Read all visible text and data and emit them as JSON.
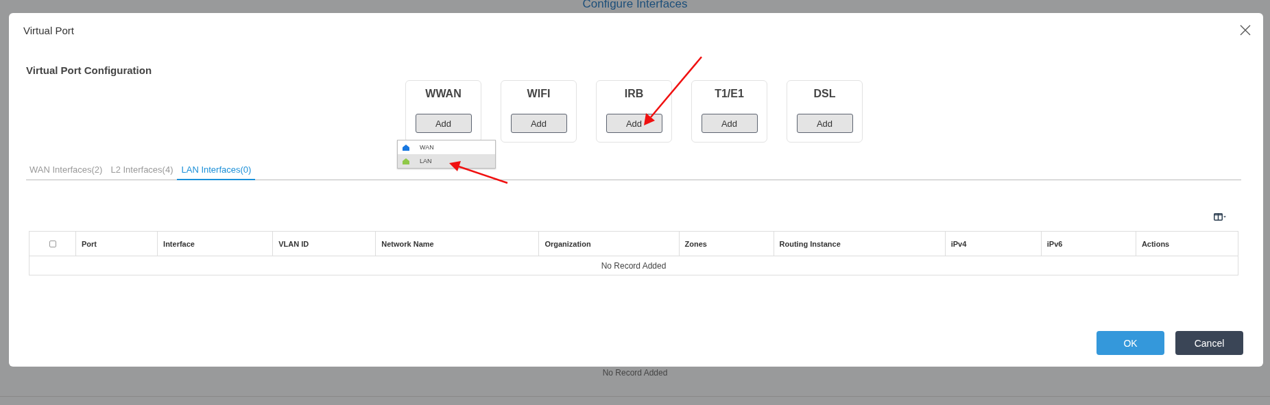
{
  "background": {
    "title": "Configure Interfaces",
    "empty_text": "No Record Added"
  },
  "dialog": {
    "title": "Virtual Port",
    "section_title": "Virtual Port Configuration",
    "port_types": [
      {
        "label": "WWAN",
        "button": "Add"
      },
      {
        "label": "WIFI",
        "button": "Add"
      },
      {
        "label": "IRB",
        "button": "Add"
      },
      {
        "label": "T1/E1",
        "button": "Add"
      },
      {
        "label": "DSL",
        "button": "Add"
      }
    ],
    "add_menu": [
      {
        "label": "WAN",
        "selected": false,
        "color": "#1877e0"
      },
      {
        "label": "LAN",
        "selected": true,
        "color": "#8fc848"
      }
    ],
    "tabs": [
      {
        "label": "WAN Interfaces(2)",
        "selected": false
      },
      {
        "label": "L2 Interfaces(4)",
        "selected": false
      },
      {
        "label": "LAN Interfaces(0)",
        "selected": true
      }
    ],
    "table": {
      "select_all": {
        "checked": false
      },
      "columns": [
        "Port",
        "Interface",
        "VLAN ID",
        "Network Name",
        "Organization",
        "Zones",
        "Routing Instance",
        "iPv4",
        "iPv6",
        "Actions"
      ],
      "empty_text": "No Record Added"
    },
    "buttons": [
      {
        "label": "OK",
        "kind": "primary"
      },
      {
        "label": "Cancel",
        "kind": "secondary"
      }
    ]
  }
}
